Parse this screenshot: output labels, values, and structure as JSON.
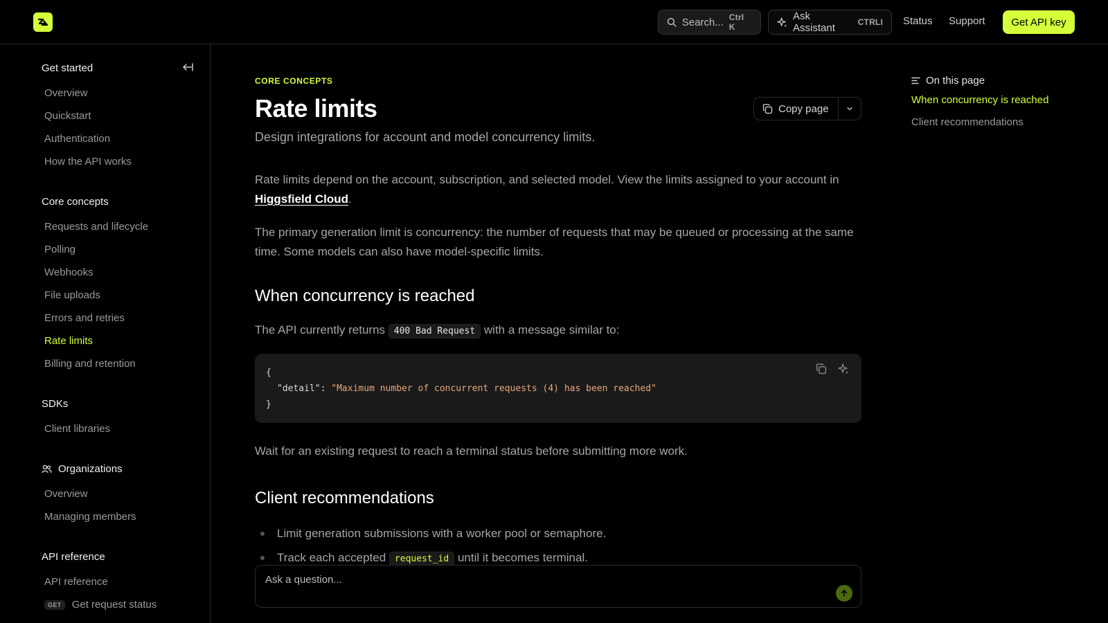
{
  "header": {
    "search_placeholder": "Search...",
    "search_shortcut": "Ctrl K",
    "ask_label": "Ask Assistant",
    "ask_shortcut": "CTRLI",
    "status": "Status",
    "support": "Support",
    "cta": "Get API key",
    "accent": "#d4ff3a"
  },
  "sidebar": {
    "sections": [
      {
        "title": "Get started",
        "items": [
          "Overview",
          "Quickstart",
          "Authentication",
          "How the API works"
        ]
      },
      {
        "title": "Core concepts",
        "items": [
          "Requests and lifecycle",
          "Polling",
          "Webhooks",
          "File uploads",
          "Errors and retries",
          "Rate limits",
          "Billing and retention"
        ]
      },
      {
        "title": "SDKs",
        "items": [
          "Client libraries"
        ]
      },
      {
        "title": "Organizations",
        "items": [
          "Overview",
          "Managing members"
        ]
      },
      {
        "title": "API reference",
        "items": [
          "API reference",
          "Get request status"
        ]
      }
    ],
    "active_item": "Rate limits",
    "method_tag": "GET"
  },
  "main": {
    "eyebrow": "CORE CONCEPTS",
    "title": "Rate limits",
    "subtitle": "Design integrations for account and model concurrency limits.",
    "copy_page": "Copy page",
    "para1_a": "Rate limits depend on the account, subscription, and selected model. View the limits assigned to your account in",
    "para1_link": "Higgsfield Cloud",
    "para1_b": ".",
    "para2": "The primary generation limit is concurrency: the number of requests that may be queued or processing at the same time. Some models can also have model-specific limits.",
    "h2_concurrency": "When concurrency is reached",
    "returns_a": "The API currently returns",
    "returns_code": "400 Bad Request",
    "returns_b": "with a message similar to:",
    "code_open": "{",
    "code_key": "\"detail\"",
    "code_colon": ": ",
    "code_value": "\"Maximum number of concurrent requests (4) has been reached\"",
    "code_close": "}",
    "wait_text": "Wait for an existing request to reach a terminal status before submitting more work.",
    "h2_client": "Client recommendations",
    "bullet1": "Limit generation submissions with a worker pool or semaphore.",
    "bullet2_a": "Track each accepted",
    "bullet2_code": "request_id",
    "bullet2_b": "until it becomes terminal.",
    "ask_placeholder": "Ask a question..."
  },
  "toc": {
    "title": "On this page",
    "items": [
      "When concurrency is reached",
      "Client recommendations"
    ]
  }
}
